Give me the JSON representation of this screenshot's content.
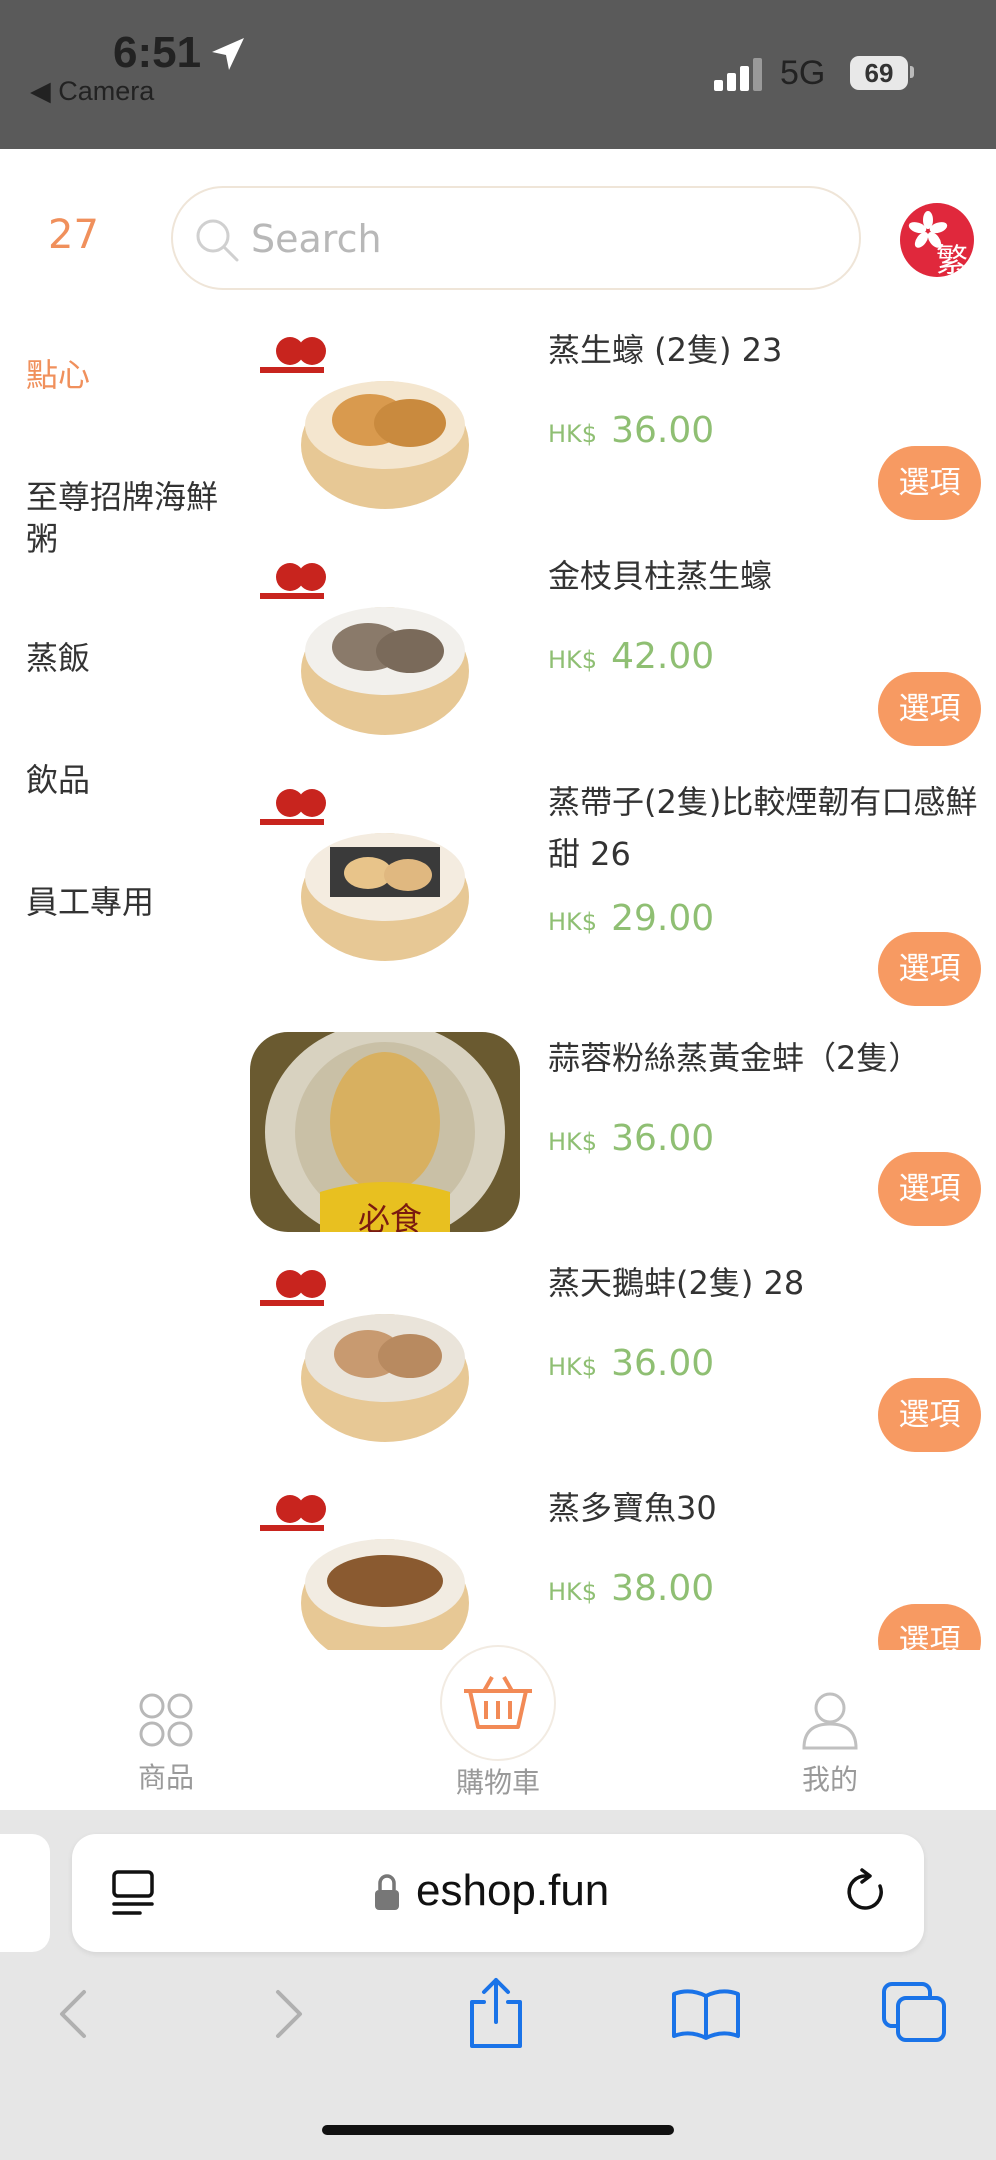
{
  "status_bar": {
    "time": "6:51",
    "back_app": "Camera",
    "network": "5G",
    "battery": "69"
  },
  "header": {
    "cart_count": "27",
    "search_placeholder": "Search",
    "language": "繁"
  },
  "categories": [
    {
      "label": "點心",
      "active": true
    },
    {
      "label": "至尊招牌海鮮粥",
      "active": false
    },
    {
      "label": "蒸飯",
      "active": false
    },
    {
      "label": "飲品",
      "active": false
    },
    {
      "label": "員工專用",
      "active": false
    }
  ],
  "products": [
    {
      "name": "蒸生蠔 (2隻) 23",
      "currency": "HK$",
      "price": "36.00",
      "option": "選項"
    },
    {
      "name": "金枝貝柱蒸生蠔",
      "currency": "HK$",
      "price": "42.00",
      "option": "選項"
    },
    {
      "name": "蒸帶子(2隻)比較煙韌有口感鮮甜 26",
      "currency": "HK$",
      "price": "29.00",
      "option": "選項"
    },
    {
      "name": "蒜蓉粉絲蒸黃金蚌（2隻）",
      "currency": "HK$",
      "price": "36.00",
      "option": "選項",
      "badge": "必食"
    },
    {
      "name": "蒸天鵝蚌(2隻) 28",
      "currency": "HK$",
      "price": "36.00",
      "option": "選項"
    },
    {
      "name": "蒸多寶魚30",
      "currency": "HK$",
      "price": "38.00",
      "option": "選項"
    }
  ],
  "tabbar": {
    "products": "商品",
    "cart": "購物車",
    "mine": "我的"
  },
  "browser": {
    "url": "eshop.fun"
  },
  "colors": {
    "accent": "#f79a62",
    "price": "#8fbf73",
    "status_bar": "#5a5a5a",
    "ios_blue": "#1a73e8"
  }
}
